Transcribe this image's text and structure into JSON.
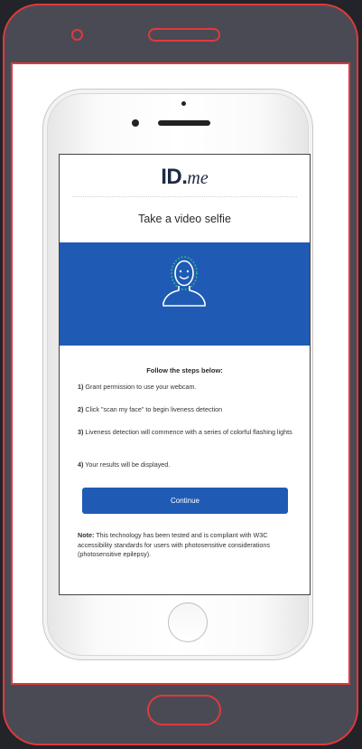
{
  "brand": {
    "id": "ID",
    "suffix": "me"
  },
  "page": {
    "title": "Take a video selfie"
  },
  "steps": {
    "heading": "Follow the steps below:",
    "items": [
      {
        "num": "1)",
        "text": "Grant permission to use your webcam."
      },
      {
        "num": "2)",
        "text": "Click \"scan my face\" to begin liveness detection"
      },
      {
        "num": "3)",
        "text": "Liveness detection will commence with a series of colorful flashing lights"
      },
      {
        "num": "4)",
        "text": "Your results will be displayed."
      }
    ]
  },
  "actions": {
    "continue_label": "Continue"
  },
  "note": {
    "label": "Note:",
    "text": "This technology has been tested and is compliant with W3C accessibility standards for users with photosensitive considerations (photosensitive epilepsy)."
  },
  "colors": {
    "primary_blue": "#1f5bb5",
    "face_green": "#3bd06b",
    "frame_red": "#e03a3a",
    "frame_dark": "#4a4a55"
  },
  "icons": {
    "hero": "face-scan-icon"
  }
}
